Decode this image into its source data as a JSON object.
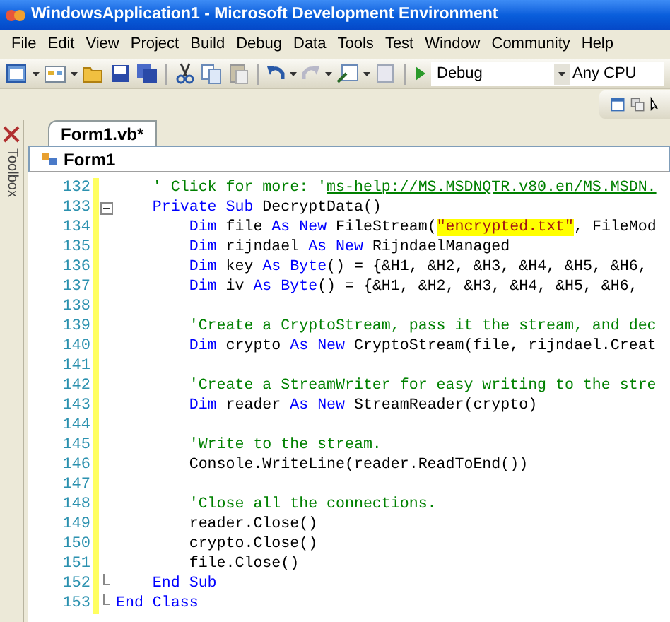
{
  "window": {
    "title": "WindowsApplication1 - Microsoft Development Environment"
  },
  "menu": [
    "File",
    "Edit",
    "View",
    "Project",
    "Build",
    "Debug",
    "Data",
    "Tools",
    "Test",
    "Window",
    "Community",
    "Help"
  ],
  "toolbar": {
    "configuration": "Debug",
    "platform": "Any CPU"
  },
  "toolbox": {
    "label": "Toolbox"
  },
  "tabs": [
    {
      "label": "Form1.vb*",
      "selected": true
    }
  ],
  "breadcrumb": "Form1",
  "code": [
    {
      "number": "132",
      "collapsible": false,
      "block_end": false,
      "parts": [
        {
          "kind": "comment",
          "text": "    ' Click for more: '"
        },
        {
          "kind": "link",
          "text": "ms-help://MS.MSDNQTR.v80.en/MS.MSDN."
        }
      ]
    },
    {
      "number": "133",
      "collapsible": true,
      "block_end": false,
      "parts": [
        {
          "kind": "keyword",
          "text": "    Private Sub"
        },
        {
          "kind": "plain",
          "text": " DecryptData()"
        }
      ]
    },
    {
      "number": "134",
      "collapsible": false,
      "block_end": false,
      "parts": [
        {
          "kind": "keyword",
          "text": "        Dim"
        },
        {
          "kind": "plain",
          "text": " file "
        },
        {
          "kind": "keyword",
          "text": "As New"
        },
        {
          "kind": "plain",
          "text": " FileStream("
        },
        {
          "kind": "highlight",
          "text": "\"encrypted.txt\""
        },
        {
          "kind": "plain",
          "text": ", FileMod"
        }
      ]
    },
    {
      "number": "135",
      "collapsible": false,
      "block_end": false,
      "parts": [
        {
          "kind": "keyword",
          "text": "        Dim"
        },
        {
          "kind": "plain",
          "text": " rijndael "
        },
        {
          "kind": "keyword",
          "text": "As New"
        },
        {
          "kind": "plain",
          "text": " RijndaelManaged"
        }
      ]
    },
    {
      "number": "136",
      "collapsible": false,
      "block_end": false,
      "parts": [
        {
          "kind": "keyword",
          "text": "        Dim"
        },
        {
          "kind": "plain",
          "text": " key "
        },
        {
          "kind": "keyword",
          "text": "As Byte"
        },
        {
          "kind": "plain",
          "text": "() = {&H1, &H2, &H3, &H4, &H5, &H6,"
        }
      ]
    },
    {
      "number": "137",
      "collapsible": false,
      "block_end": false,
      "parts": [
        {
          "kind": "keyword",
          "text": "        Dim"
        },
        {
          "kind": "plain",
          "text": " iv "
        },
        {
          "kind": "keyword",
          "text": "As Byte"
        },
        {
          "kind": "plain",
          "text": "() = {&H1, &H2, &H3, &H4, &H5, &H6,"
        }
      ]
    },
    {
      "number": "138",
      "collapsible": false,
      "block_end": false
    },
    {
      "number": "139",
      "collapsible": false,
      "block_end": false,
      "parts": [
        {
          "kind": "comment",
          "text": "        'Create a CryptoStream, pass it the stream, and dec"
        }
      ]
    },
    {
      "number": "140",
      "collapsible": false,
      "block_end": false,
      "parts": [
        {
          "kind": "keyword",
          "text": "        Dim"
        },
        {
          "kind": "plain",
          "text": " crypto "
        },
        {
          "kind": "keyword",
          "text": "As New"
        },
        {
          "kind": "plain",
          "text": " CryptoStream(file, rijndael.Creat"
        }
      ]
    },
    {
      "number": "141",
      "collapsible": false,
      "block_end": false
    },
    {
      "number": "142",
      "collapsible": false,
      "block_end": false,
      "parts": [
        {
          "kind": "comment",
          "text": "        'Create a StreamWriter for easy writing to the stre"
        }
      ]
    },
    {
      "number": "143",
      "collapsible": false,
      "block_end": false,
      "parts": [
        {
          "kind": "keyword",
          "text": "        Dim"
        },
        {
          "kind": "plain",
          "text": " reader "
        },
        {
          "kind": "keyword",
          "text": "As New"
        },
        {
          "kind": "plain",
          "text": " StreamReader(crypto)"
        }
      ]
    },
    {
      "number": "144",
      "collapsible": false,
      "block_end": false
    },
    {
      "number": "145",
      "collapsible": false,
      "block_end": false,
      "parts": [
        {
          "kind": "comment",
          "text": "        'Write to the stream."
        }
      ]
    },
    {
      "number": "146",
      "collapsible": false,
      "block_end": false,
      "parts": [
        {
          "kind": "plain",
          "text": "        Console.WriteLine(reader.ReadToEnd())"
        }
      ]
    },
    {
      "number": "147",
      "collapsible": false,
      "block_end": false
    },
    {
      "number": "148",
      "collapsible": false,
      "block_end": false,
      "parts": [
        {
          "kind": "comment",
          "text": "        'Close all the connections."
        }
      ]
    },
    {
      "number": "149",
      "collapsible": false,
      "block_end": false,
      "parts": [
        {
          "kind": "plain",
          "text": "        reader.Close()"
        }
      ]
    },
    {
      "number": "150",
      "collapsible": false,
      "block_end": false,
      "parts": [
        {
          "kind": "plain",
          "text": "        crypto.Close()"
        }
      ]
    },
    {
      "number": "151",
      "collapsible": false,
      "block_end": false,
      "parts": [
        {
          "kind": "plain",
          "text": "        file.Close()"
        }
      ]
    },
    {
      "number": "152",
      "collapsible": false,
      "block_end": true,
      "parts": [
        {
          "kind": "keyword",
          "text": "    End Sub"
        }
      ]
    },
    {
      "number": "153",
      "collapsible": false,
      "block_end": true,
      "parts": [
        {
          "kind": "keyword",
          "text": "End Class"
        }
      ]
    }
  ]
}
